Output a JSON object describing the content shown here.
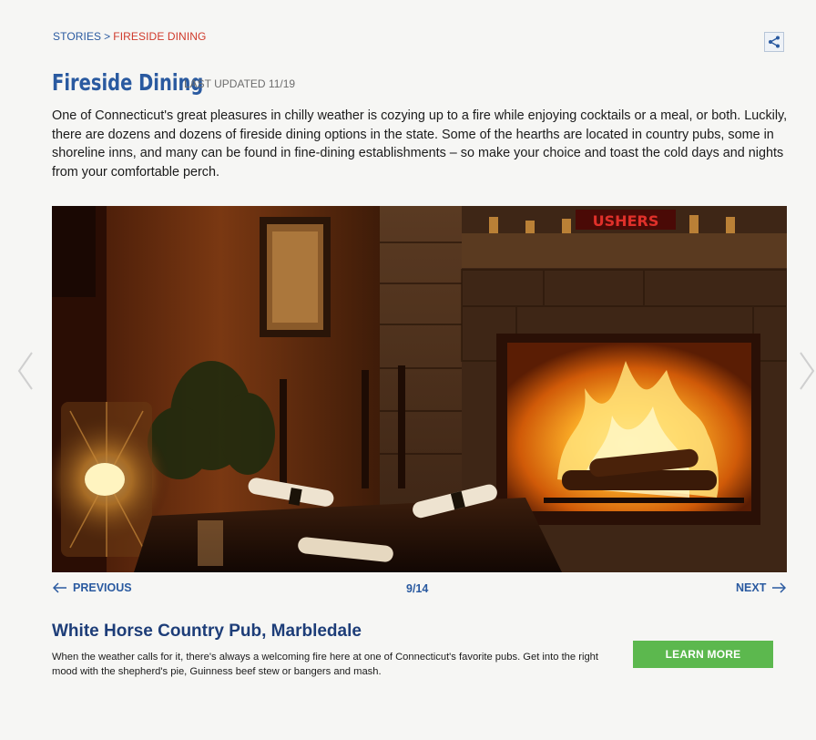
{
  "breadcrumb": {
    "root": "STORIES",
    "separator": ">",
    "current": "FIRESIDE DINING"
  },
  "header": {
    "title": "Fireside Dining",
    "updated": "LAST UPDATED 11/19",
    "share_icon": "share-icon"
  },
  "intro": "One of Connecticut's great pleasures in chilly weather is cozying up to a fire while enjoying cocktails or a meal, or both. Luckily, there are dozens and dozens of fireside dining options in the state. Some of the hearths are located in country pubs, some in shoreline inns, and many can be found in fine-dining establishments – so make your choice and toast the cold days and nights from your comfortable perch.",
  "hero": {
    "sign_text": "USHERS"
  },
  "pager": {
    "prev_label": "PREVIOUS",
    "count": "9/14",
    "next_label": "NEXT"
  },
  "item": {
    "title": "White Horse Country Pub, Marbledale",
    "description": "When the weather calls for it, there's always a welcoming fire here at one of Connecticut's favorite pubs. Get into the right mood with the shepherd's pie, Guinness beef stew or bangers and mash.",
    "cta_label": "LEARN MORE"
  },
  "colors": {
    "brand_blue": "#2a5aa0",
    "breadcrumb_active": "#d03a2b",
    "cta_green": "#5cb84e"
  }
}
